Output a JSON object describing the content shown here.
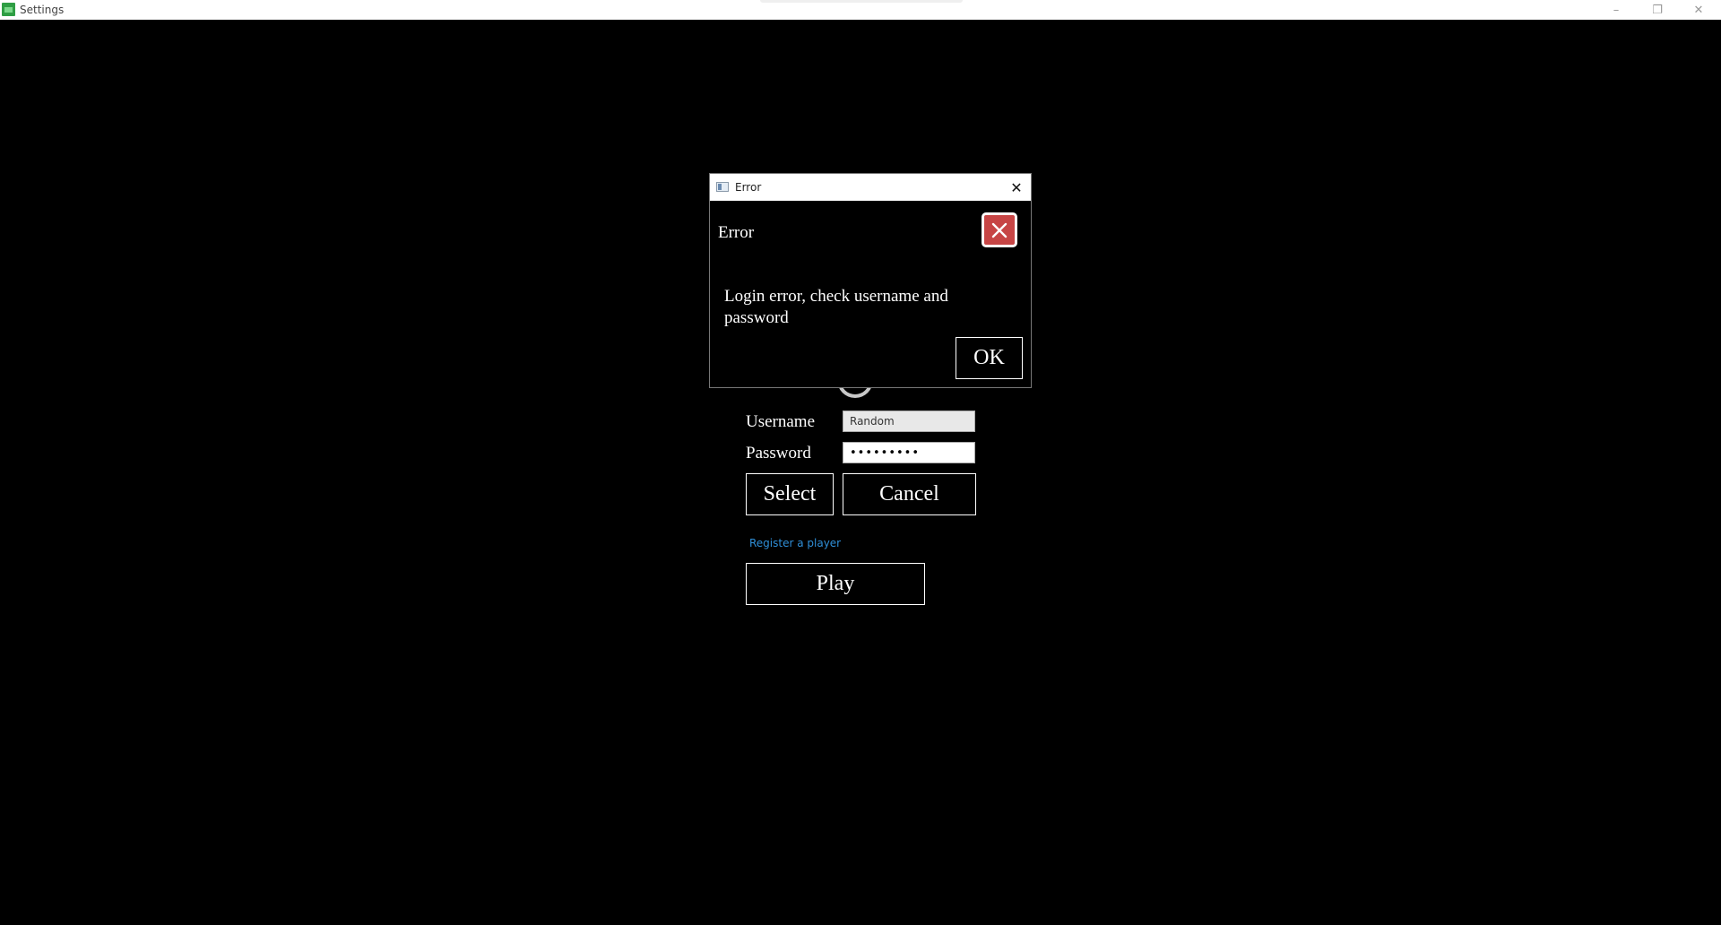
{
  "window": {
    "title": "Settings",
    "minimize_glyph": "–",
    "restore_glyph": "❐",
    "close_glyph": "✕"
  },
  "login": {
    "username_label": "Username",
    "username_value": "Random",
    "password_label": "Password",
    "password_value": "•••••••••",
    "select_label": "Select",
    "cancel_label": "Cancel",
    "register_link": "Register a player",
    "play_label": "Play"
  },
  "dialog": {
    "window_title": "Error",
    "close_glyph": "✕",
    "heading": "Error",
    "message": "Login error, check username and password",
    "ok_label": "OK",
    "error_icon_color": "#c74545"
  },
  "icons": [
    "app-icon",
    "dialog-window-icon",
    "error-icon",
    "close-icon",
    "minimize-icon",
    "restore-icon"
  ]
}
